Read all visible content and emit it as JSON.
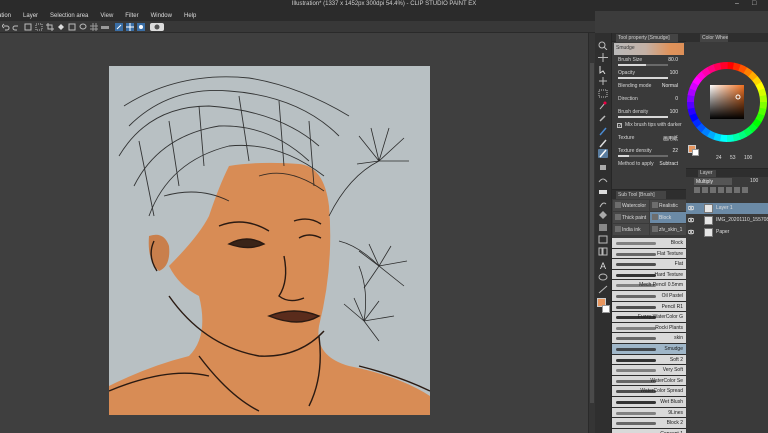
{
  "window": {
    "title": "Illustration* (1337 x 1452px 300dpi 54.4%) - CLIP STUDIO PAINT EX",
    "controls": [
      "–",
      "□"
    ]
  },
  "menu": [
    "ration",
    "Layer",
    "Selection area",
    "View",
    "Filter",
    "Window",
    "Help"
  ],
  "tool_property": {
    "tab": "Tool property [Smudge]",
    "preview_label": "Smudge",
    "brush_size": {
      "label": "Brush Size",
      "value": "80.0",
      "level": 0.55
    },
    "opacity": {
      "label": "Opacity",
      "value": "100",
      "level": 1.0
    },
    "blending_mode": {
      "label": "Blending mode",
      "value": "Normal"
    },
    "direction": {
      "label": "Direction",
      "value": "0"
    },
    "brush_density": {
      "label": "Brush density",
      "value": "100",
      "level": 1.0
    },
    "mix_brush_tips": {
      "label": "Mix brush tips with darker",
      "checked": true
    },
    "texture": {
      "label": "Texture",
      "value": "画用紙"
    },
    "texture_density": {
      "label": "Texture density",
      "value": "22",
      "level": 0.22
    },
    "method_to_apply": {
      "label": "Method to apply",
      "value": "Subtract"
    }
  },
  "sub_tool": {
    "tab": "Sub Tool [Brush]",
    "grid": [
      {
        "label": "Watercolor",
        "selected": false
      },
      {
        "label": "Realistic",
        "selected": false
      },
      {
        "label": "Thick paint",
        "selected": false
      },
      {
        "label": "Block",
        "selected": true
      },
      {
        "label": "India ink",
        "selected": false
      },
      {
        "label": "zlv_skin_1",
        "selected": false
      }
    ],
    "brushes": [
      "Block",
      "Flat Texture",
      "Flat",
      "Hard Texture",
      "Mech Pencil 0.5mm",
      "Oil Pastel",
      "Pencil R1",
      "Fuzzy WaterColor G",
      "Rocki Plants",
      "skin",
      "Smudge",
      "Soft 2",
      "Very Soft",
      "WaterColor Se",
      "WaterColor Spread",
      "Wet Blush",
      "9Lines",
      "Block 2",
      "Concept 1"
    ],
    "selected_brush": "Smudge"
  },
  "color": {
    "tab": "Color Wheel",
    "main_color": "#e8965e",
    "sub_color": "#ffffff",
    "values": [
      "24",
      "53",
      "100"
    ]
  },
  "layers": {
    "tab": "Layer",
    "blend_mode": "Multiply",
    "opacity": "100",
    "items": [
      {
        "name": "Layer 1",
        "selected": true
      },
      {
        "name": "IMG_20201110_155708",
        "selected": false
      },
      {
        "name": "Paper",
        "selected": false
      }
    ]
  },
  "colors": {
    "accent": "#6b8aa6",
    "skin": "#d98c57",
    "paper": "#b9c1c4"
  }
}
